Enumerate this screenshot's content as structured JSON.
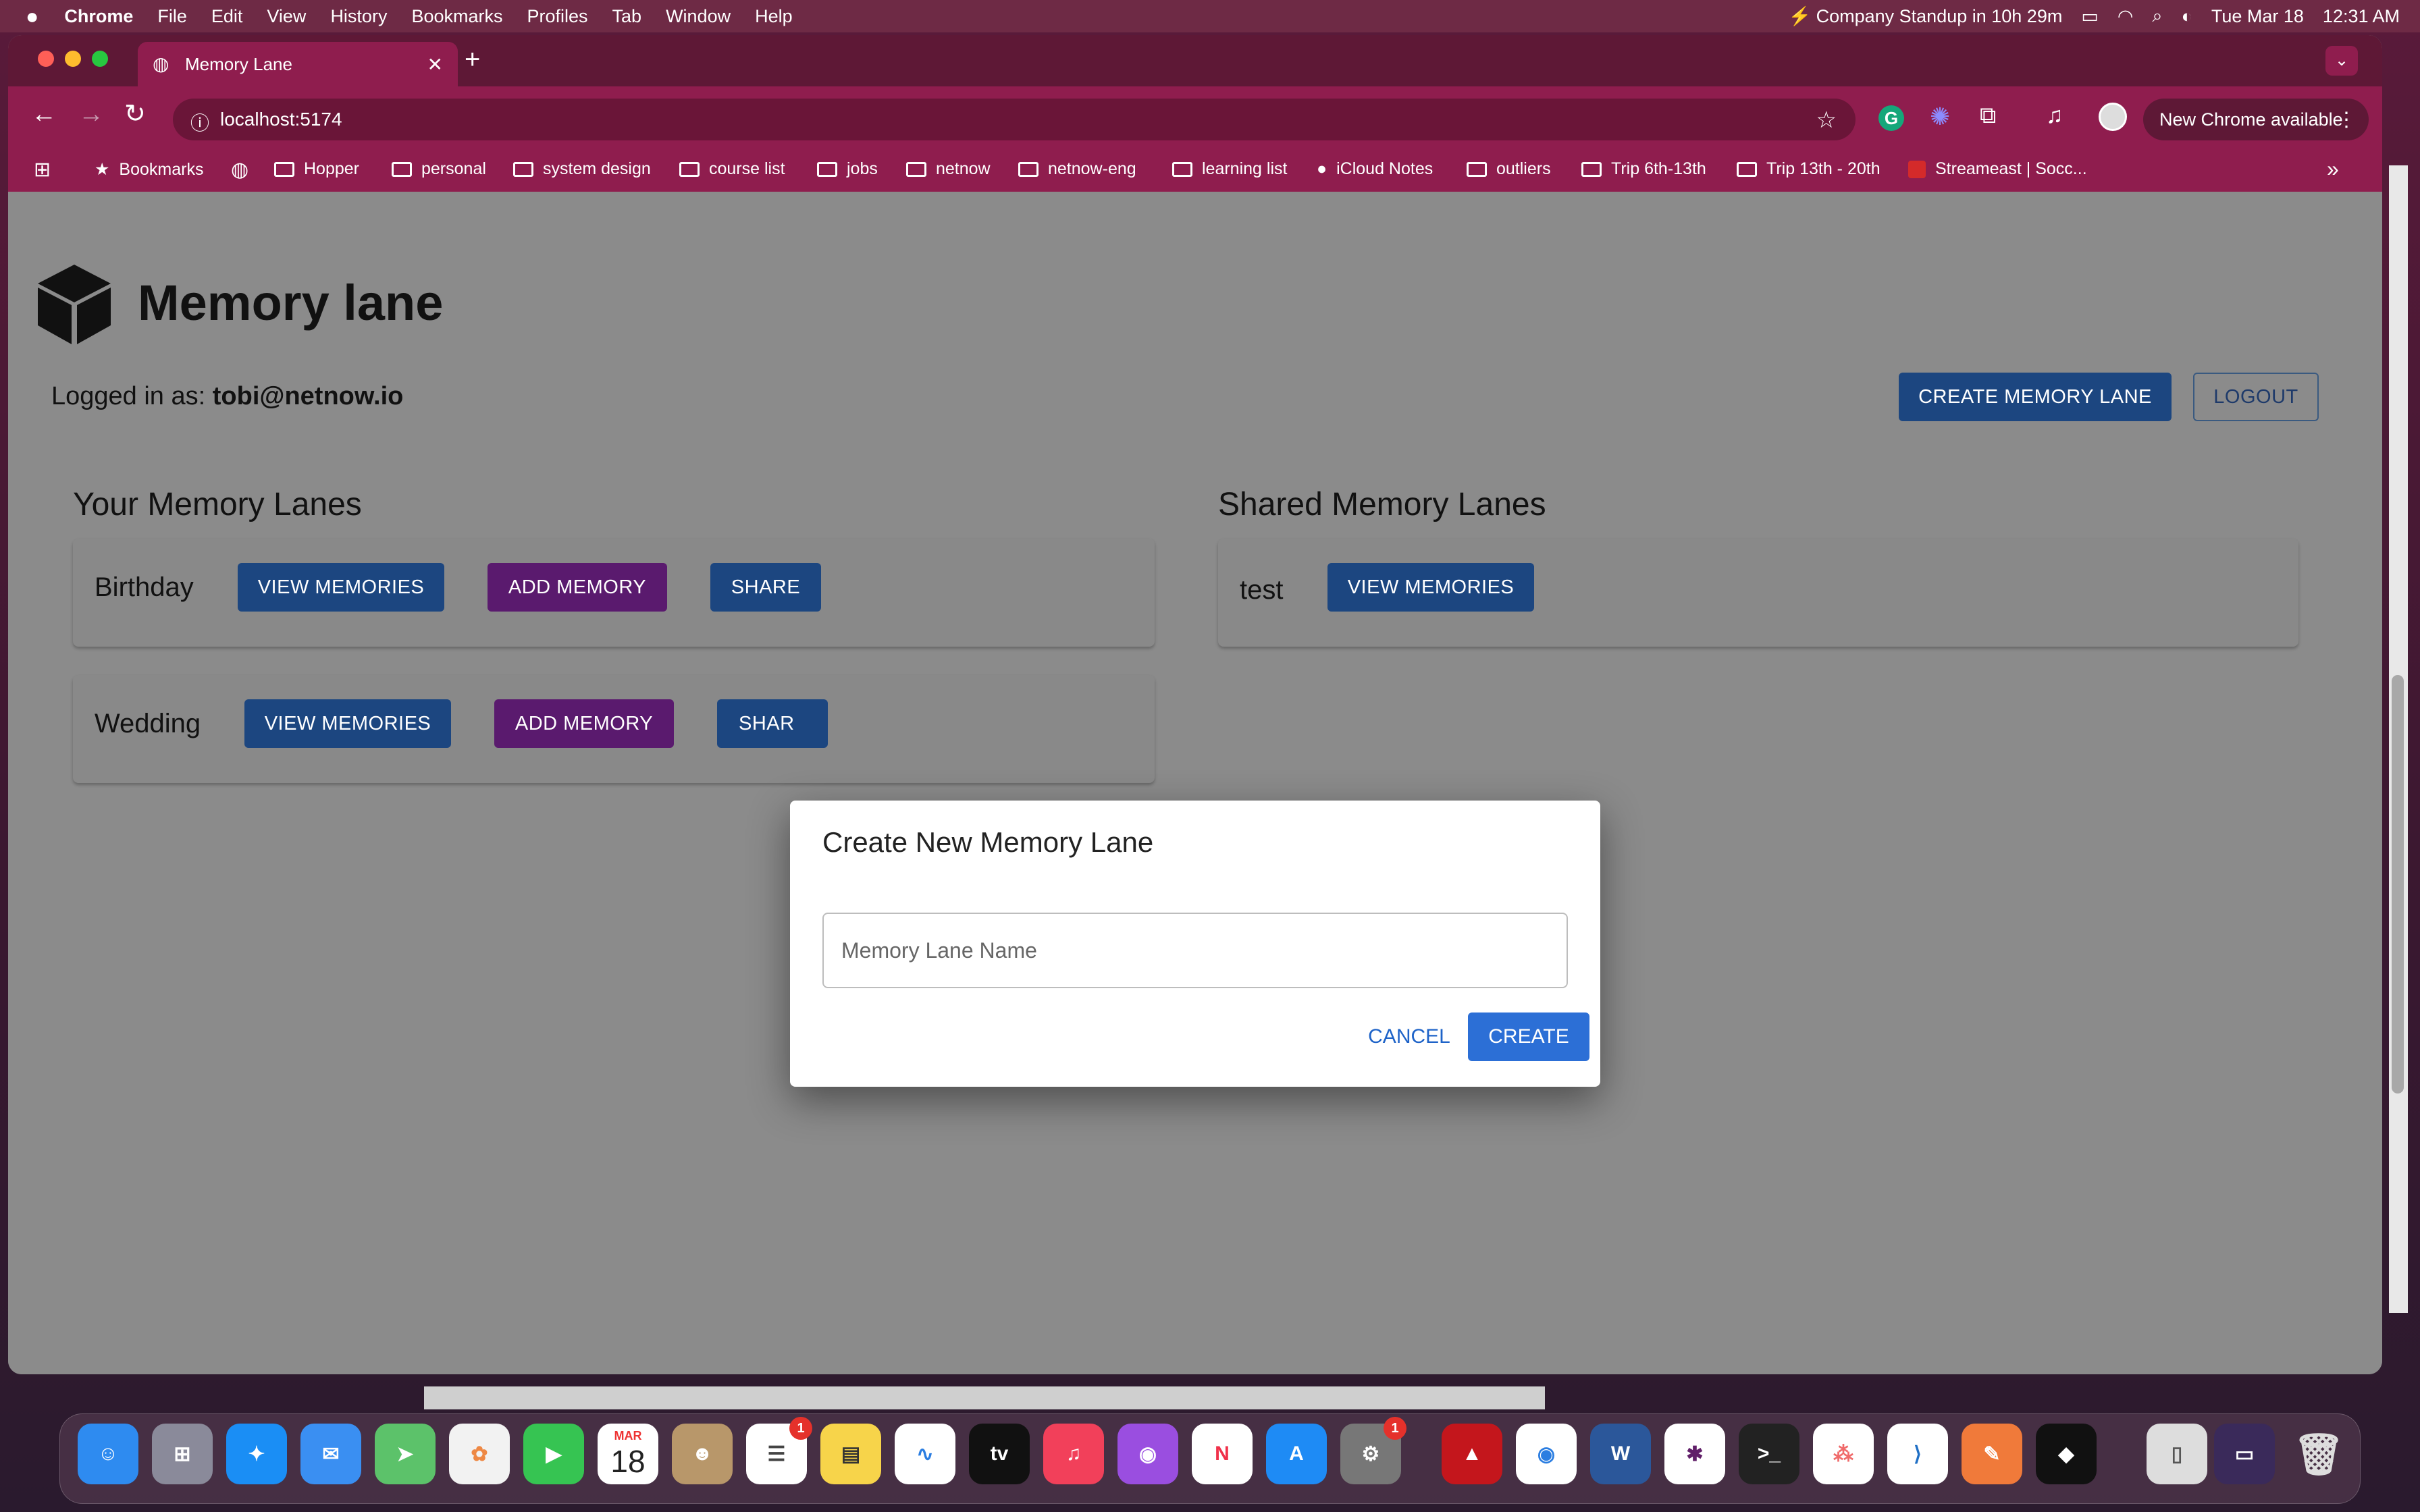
{
  "menubar": {
    "app_name": "Chrome",
    "items": [
      "File",
      "Edit",
      "View",
      "History",
      "Bookmarks",
      "Profiles",
      "Tab",
      "Window",
      "Help"
    ],
    "meeting": "Company Standup in 10h 29m",
    "date": "Tue Mar 18",
    "time": "12:31 AM"
  },
  "browser": {
    "tab_title": "Memory Lane",
    "url": "localhost:5174",
    "update_label": "New Chrome available",
    "bookmarks": [
      "Bookmarks",
      "Hopper",
      "personal",
      "system design",
      "course list",
      "jobs",
      "netnow",
      "netnow-eng",
      "learning list",
      "iCloud Notes",
      "outliers",
      "Trip 6th-13th",
      "Trip 13th - 20th",
      "Streameast | Socc..."
    ]
  },
  "app": {
    "title": "Memory lane",
    "logged_in_label": "Logged in as:",
    "user_email": "tobi@netnow.io",
    "create_button": "CREATE MEMORY LANE",
    "logout_button": "LOGOUT",
    "your_lanes_heading": "Your Memory Lanes",
    "shared_lanes_heading": "Shared Memory Lanes",
    "your_lanes": [
      {
        "name": "Birthday",
        "view": "VIEW MEMORIES",
        "add": "ADD MEMORY",
        "share": "SHARE"
      },
      {
        "name": "Wedding",
        "view": "VIEW MEMORIES",
        "add": "ADD MEMORY",
        "share": "SHAR"
      }
    ],
    "shared_lanes": [
      {
        "name": "test",
        "view": "VIEW MEMORIES"
      }
    ]
  },
  "dialog": {
    "title": "Create New Memory Lane",
    "input_placeholder": "Memory Lane Name",
    "cancel": "CANCEL",
    "create": "CREATE"
  },
  "dock": {
    "calendar_month": "MAR",
    "calendar_day": "18",
    "reminders_badge": "1",
    "settings_badge": "1",
    "tv_label": "tv"
  },
  "colors": {
    "primary": "#1c4680",
    "secondary": "#5a1a6e",
    "dialog_primary": "#2c6fd6",
    "chrome_tab": "#8f1d4e"
  }
}
